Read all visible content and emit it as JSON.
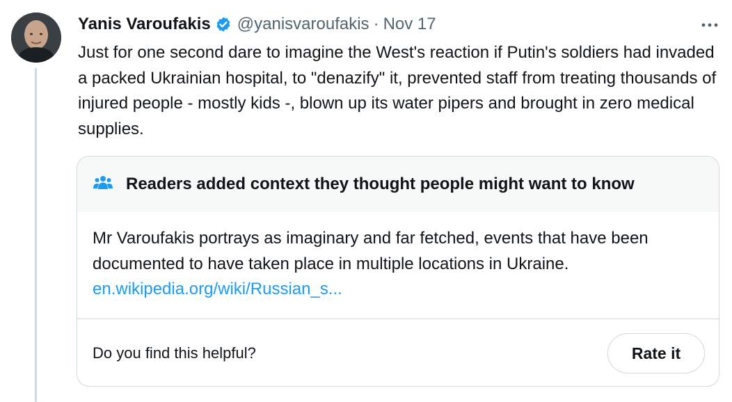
{
  "tweet": {
    "author_name": "Yanis Varoufakis",
    "handle": "@yanisvaroufakis",
    "separator": "·",
    "date": "Nov 17",
    "more_icon": "more-horizontal-icon",
    "verified_icon": "verified-badge-icon",
    "verified_color": "#1d9bf0",
    "text": "Just for one second dare to imagine the West's reaction if Putin's soldiers had invaded a packed Ukrainian hospital, to \"denazify\" it, prevented staff from treating thousands of injured people - mostly kids -, blown up its water pipers and brought in zero medical supplies."
  },
  "community_note": {
    "icon": "people-icon",
    "title": "Readers added context they thought people might want to know",
    "body": "Mr Varoufakis portrays as imaginary and far fetched, events that have been documented to have taken place in multiple locations in Ukraine.",
    "link_text": "en.wikipedia.org/wiki/Russian_s...",
    "link_color": "#1d9bf0",
    "helpful_prompt": "Do you find this helpful?",
    "rate_button": "Rate it"
  }
}
